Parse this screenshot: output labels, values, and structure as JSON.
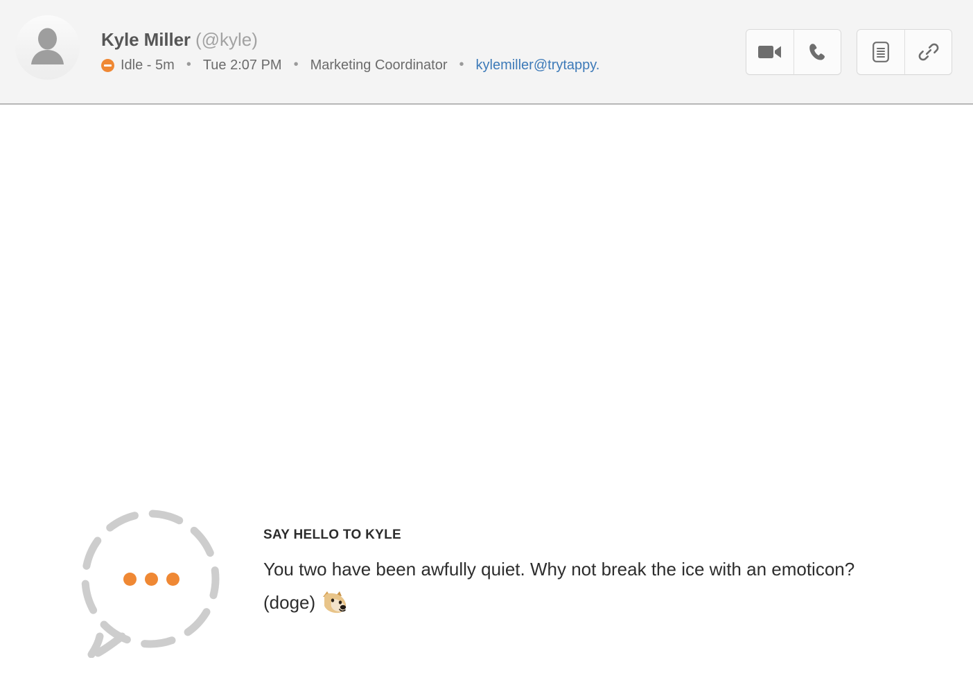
{
  "header": {
    "avatar_icon": "default-person-avatar",
    "user_name": "Kyle Miller",
    "user_handle": "(@kyle)",
    "status": {
      "icon": "idle-status-dot",
      "label": "Idle - 5m"
    },
    "separator": "•",
    "local_time": "Tue 2:07 PM",
    "job_title": "Marketing Coordinator",
    "email": "kylemiller@trytappy.",
    "actions": [
      {
        "name": "video-call-button",
        "icon": "video-camera-icon"
      },
      {
        "name": "voice-call-button",
        "icon": "phone-icon"
      },
      {
        "name": "notes-button",
        "icon": "document-icon"
      },
      {
        "name": "share-link-button",
        "icon": "link-icon"
      }
    ]
  },
  "prompt": {
    "bubble_icon": "dashed-speech-bubble-icon",
    "typing_dots": 3,
    "title": "Say hello to Kyle",
    "body": "You two have been awfully quiet. Why not break the ice with an emoticon? (doge)",
    "emoji": "doge-shiba-inu-emoji"
  },
  "colors": {
    "accent_orange": "#ef8834",
    "link_blue": "#3d7ab8",
    "header_bg": "#f4f4f4",
    "header_border": "#b7b7b7",
    "bubble_gray": "#cdcdcd",
    "body_text": "#2d2d2d"
  }
}
